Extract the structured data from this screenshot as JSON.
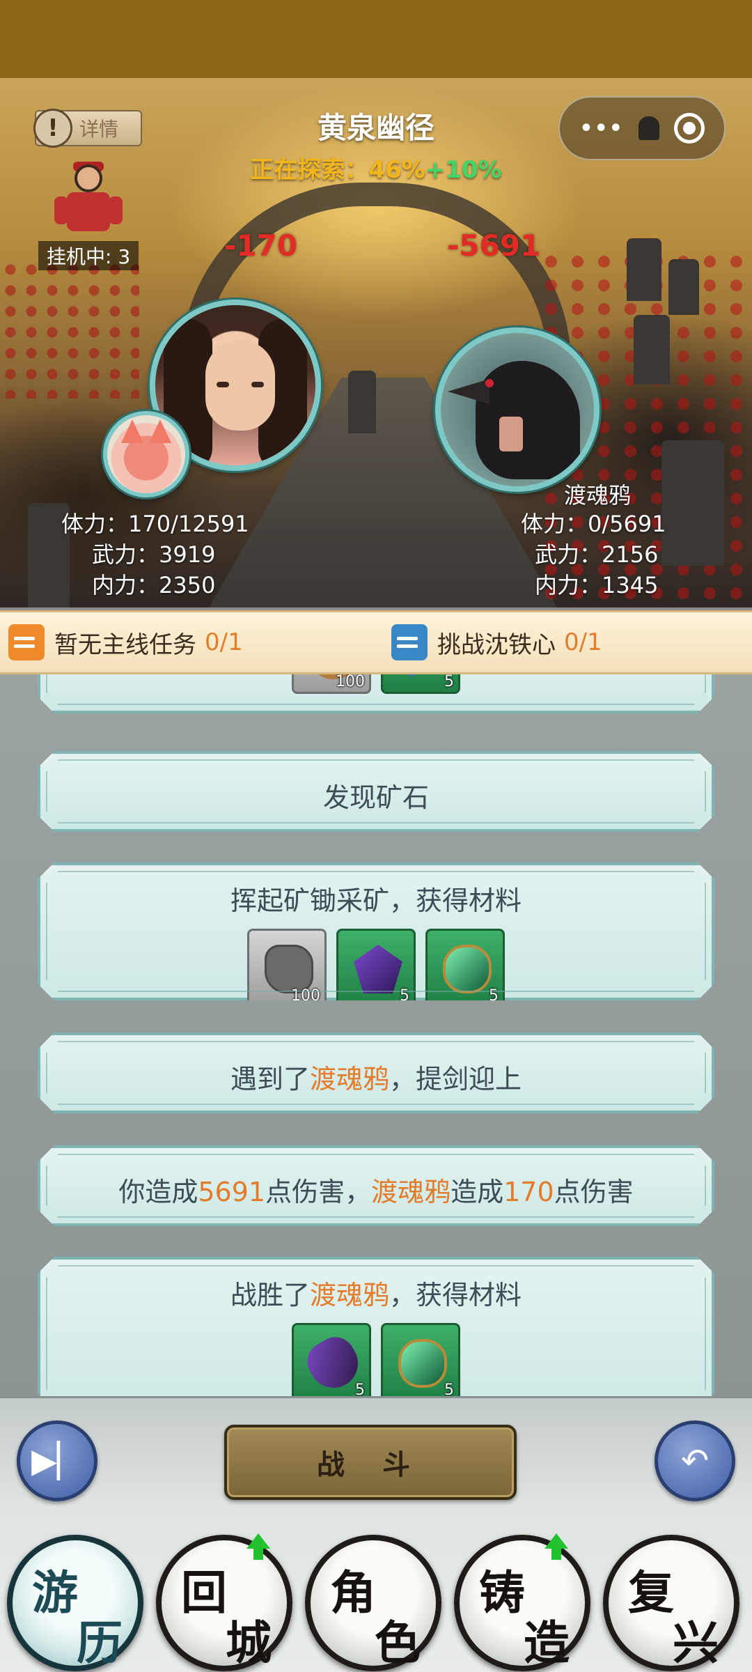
{
  "header": {
    "detail_label": "详情",
    "location": "黄泉幽径",
    "explore_label": "正在探索：46%",
    "explore_bonus": "+10%",
    "capsule_dots": "•••"
  },
  "battle": {
    "idle_label": "挂机中: 3",
    "player_damage_taken": "-170",
    "enemy_damage_taken": "-5691",
    "player": {
      "hp": "体力：170/12591",
      "atk": "武力：3919",
      "inner": "内力：2350"
    },
    "enemy": {
      "name": "渡魂鸦",
      "hp": "体力：0/5691",
      "atk": "武力：2156",
      "inner": "内力：1345"
    }
  },
  "quests": [
    {
      "title": "暂无主线任务",
      "count": "0/1",
      "color": "#ef8a2a"
    },
    {
      "title": "挑战沈铁心",
      "count": "0/1",
      "color": "#3a87c6"
    }
  ],
  "log": {
    "card0": {
      "items": [
        {
          "icon": "wood-log-icon",
          "count": "100"
        },
        {
          "icon": "tool-icon",
          "count": "5"
        }
      ]
    },
    "card1": {
      "text": "发现矿石"
    },
    "card2": {
      "text": "挥起矿锄采矿，获得材料",
      "items": [
        {
          "icon": "ore-rock-icon",
          "count": "100"
        },
        {
          "icon": "purple-crystal-icon",
          "count": "5"
        },
        {
          "icon": "jade-gem-icon",
          "count": "5"
        }
      ]
    },
    "card3": {
      "pre": "遇到了",
      "enemy": "渡魂鸦",
      "post": "，提剑迎上"
    },
    "card4": {
      "t1": "你造成",
      "n1": "5691",
      "t2": "点伤害，",
      "enemy": "渡魂鸦",
      "t3": "造成",
      "n2": "170",
      "t4": "点伤害"
    },
    "card5": {
      "pre": "战胜了",
      "enemy": "渡魂鸦",
      "post": "，获得材料",
      "items": [
        {
          "icon": "purple-larva-icon",
          "count": "5"
        },
        {
          "icon": "jade-gem-icon",
          "count": "5"
        }
      ]
    }
  },
  "controls": {
    "skip_icon": "skip-icon",
    "fight_label": "战 斗",
    "back_icon": "back-arrow-icon"
  },
  "nav": [
    {
      "c1": "游",
      "c2": "历",
      "active": true
    },
    {
      "c1": "回",
      "c2": "城",
      "badge": true
    },
    {
      "c1": "角",
      "c2": "色"
    },
    {
      "c1": "铸",
      "c2": "造",
      "badge": true
    },
    {
      "c1": "复",
      "c2": "兴"
    }
  ],
  "colors": {
    "status_bar": "#8b6914",
    "highlight": "#e37b2a",
    "damage": "#e12c25",
    "explore": "#f2b51c",
    "bonus": "#43d466"
  }
}
